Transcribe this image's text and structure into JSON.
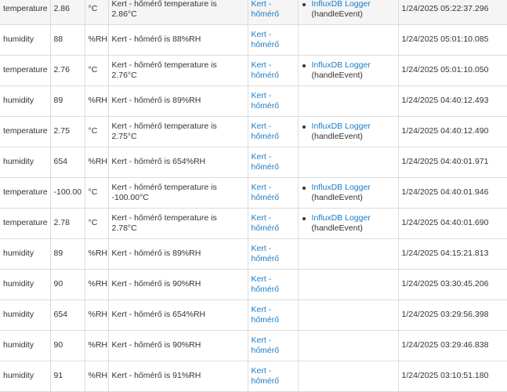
{
  "events": [
    {
      "name": "temperature",
      "value": "2.86",
      "unit": "°C",
      "description": "Kert - hőmérő temperature is 2.86°C",
      "device": "Kert - hőmérő",
      "app_name": "InfluxDB Logger",
      "app_handler": "(handleEvent)",
      "date": "1/24/2025 05:22:37.296"
    },
    {
      "name": "humidity",
      "value": "88",
      "unit": "%RH",
      "description": "Kert - hőmérő is 88%RH",
      "device": "Kert - hőmérő",
      "app_name": "",
      "app_handler": "",
      "date": "1/24/2025 05:01:10.085"
    },
    {
      "name": "temperature",
      "value": "2.76",
      "unit": "°C",
      "description": "Kert - hőmérő temperature is 2.76°C",
      "device": "Kert - hőmérő",
      "app_name": "InfluxDB Logger",
      "app_handler": "(handleEvent)",
      "date": "1/24/2025 05:01:10.050"
    },
    {
      "name": "humidity",
      "value": "89",
      "unit": "%RH",
      "description": "Kert - hőmérő is 89%RH",
      "device": "Kert - hőmérő",
      "app_name": "",
      "app_handler": "",
      "date": "1/24/2025 04:40:12.493"
    },
    {
      "name": "temperature",
      "value": "2.75",
      "unit": "°C",
      "description": "Kert - hőmérő temperature is 2.75°C",
      "device": "Kert - hőmérő",
      "app_name": "InfluxDB Logger",
      "app_handler": "(handleEvent)",
      "date": "1/24/2025 04:40:12.490"
    },
    {
      "name": "humidity",
      "value": "654",
      "unit": "%RH",
      "description": "Kert - hőmérő is 654%RH",
      "device": "Kert - hőmérő",
      "app_name": "",
      "app_handler": "",
      "date": "1/24/2025 04:40:01.971"
    },
    {
      "name": "temperature",
      "value": "-100.00",
      "unit": "°C",
      "description": "Kert - hőmérő temperature is -100.00°C",
      "device": "Kert - hőmérő",
      "app_name": "InfluxDB Logger",
      "app_handler": "(handleEvent)",
      "date": "1/24/2025 04:40:01.946"
    },
    {
      "name": "temperature",
      "value": "2.78",
      "unit": "°C",
      "description": "Kert - hőmérő temperature is 2.78°C",
      "device": "Kert - hőmérő",
      "app_name": "InfluxDB Logger",
      "app_handler": "(handleEvent)",
      "date": "1/24/2025 04:40:01.690"
    },
    {
      "name": "humidity",
      "value": "89",
      "unit": "%RH",
      "description": "Kert - hőmérő is 89%RH",
      "device": "Kert - hőmérő",
      "app_name": "",
      "app_handler": "",
      "date": "1/24/2025 04:15:21.813"
    },
    {
      "name": "humidity",
      "value": "90",
      "unit": "%RH",
      "description": "Kert - hőmérő is 90%RH",
      "device": "Kert - hőmérő",
      "app_name": "",
      "app_handler": "",
      "date": "1/24/2025 03:30:45.206"
    },
    {
      "name": "humidity",
      "value": "654",
      "unit": "%RH",
      "description": "Kert - hőmérő is 654%RH",
      "device": "Kert - hőmérő",
      "app_name": "",
      "app_handler": "",
      "date": "1/24/2025 03:29:56.398"
    },
    {
      "name": "humidity",
      "value": "90",
      "unit": "%RH",
      "description": "Kert - hőmérő is 90%RH",
      "device": "Kert - hőmérő",
      "app_name": "",
      "app_handler": "",
      "date": "1/24/2025 03:29:46.838"
    },
    {
      "name": "humidity",
      "value": "91",
      "unit": "%RH",
      "description": "Kert - hőmérő is 91%RH",
      "device": "Kert - hőmérő",
      "app_name": "",
      "app_handler": "",
      "date": "1/24/2025 03:10:51.180"
    }
  ]
}
